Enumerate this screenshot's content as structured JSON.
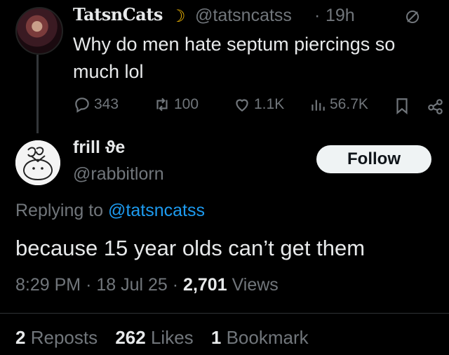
{
  "original_tweet": {
    "display_name": "TatsnCats",
    "handle": "@tatsncatss",
    "separator": "·",
    "time": "19h",
    "text": "Why do men hate septum piercings so much lol",
    "replies": "343",
    "reposts": "100",
    "likes": "1.1K",
    "views": "56.7K",
    "icons": [
      "moon-emoji",
      "no-symbol-icon",
      "reply-icon",
      "repost-icon",
      "like-icon",
      "views-icon",
      "bookmark-icon",
      "share-icon"
    ]
  },
  "reply_tweet": {
    "display_name": "frill ϑe",
    "handle": "@rabbitlorn",
    "follow_label": "Follow",
    "replying_prefix": "Replying to",
    "replying_handle": "@tatsncatss",
    "text": "because 15 year olds can’t get them",
    "time": "8:29 PM",
    "sep1": "·",
    "date": "18 Jul 25",
    "sep2": "·",
    "views_count": "2,701",
    "views_label": "Views",
    "reposts_count": "2",
    "reposts_label": "Reposts",
    "likes_count": "262",
    "likes_label": "Likes",
    "bookmarks_count": "1",
    "bookmarks_label": "Bookmark"
  },
  "colors": {
    "background": "#000000",
    "text": "#e7e9ea",
    "muted": "#71767b",
    "link": "#1d9bf0",
    "moon": "#f2b705"
  }
}
